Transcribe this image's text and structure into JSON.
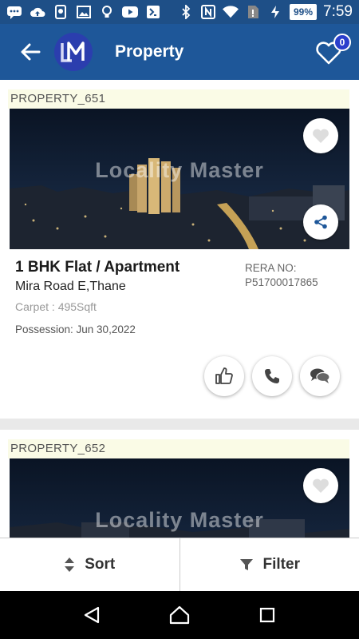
{
  "status_bar": {
    "battery": "99%",
    "time": "7:59"
  },
  "app_bar": {
    "title": "Property",
    "favorites_count": "0"
  },
  "listings": [
    {
      "id": "PROPERTY_651",
      "watermark": "Locality Master",
      "title": "1 BHK Flat / Apartment",
      "location": "Mira Road E,Thane",
      "carpet": "Carpet : 495Sqft",
      "possession": "Possession: Jun 30,2022",
      "rera_label": "RERA NO:",
      "rera_number": "P51700017865"
    },
    {
      "id": "PROPERTY_652",
      "watermark": "Locality Master"
    }
  ],
  "bottom_bar": {
    "sort_label": "Sort",
    "filter_label": "Filter"
  },
  "colors": {
    "primary": "#1e5799",
    "status_bar": "#1e4f87",
    "badge": "#2a3ecc",
    "id_strip": "#fafbe6"
  }
}
